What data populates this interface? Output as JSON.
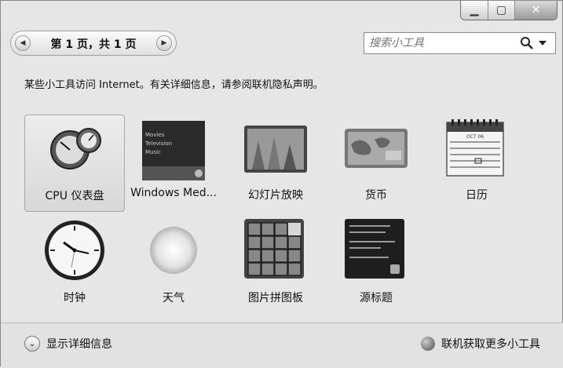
{
  "window": {
    "minimize_glyph": "▁",
    "maximize_glyph": "▢",
    "close_glyph": "✕"
  },
  "pager": {
    "text": "第 1 页，共 1 页",
    "prev_glyph": "◀",
    "next_glyph": "▶"
  },
  "search": {
    "placeholder": "搜索小工具",
    "icon": "search-icon",
    "dropdown_icon": "chevron-down-icon"
  },
  "notice": "某些小工具访问 Internet。有关详细信息，请参阅联机隐私声明。",
  "gadgets": [
    {
      "label": "CPU 仪表盘",
      "icon": "cpu-meter-icon",
      "selected": true
    },
    {
      "label": "Windows Med...",
      "icon": "windows-media-center-icon",
      "selected": false
    },
    {
      "label": "幻灯片放映",
      "icon": "slideshow-icon",
      "selected": false
    },
    {
      "label": "货币",
      "icon": "currency-icon",
      "selected": false
    },
    {
      "label": "日历",
      "icon": "calendar-icon",
      "selected": false
    },
    {
      "label": "时钟",
      "icon": "clock-icon",
      "selected": false
    },
    {
      "label": "天气",
      "icon": "weather-icon",
      "selected": false
    },
    {
      "label": "图片拼图板",
      "icon": "picture-puzzle-icon",
      "selected": false
    },
    {
      "label": "源标题",
      "icon": "feed-headlines-icon",
      "selected": false
    }
  ],
  "gadget_art_text": {
    "media_center": [
      "Movies",
      "Television",
      "Music"
    ],
    "calendar_month": "OCT 06"
  },
  "footer": {
    "details_label": "显示详细信息",
    "details_glyph": "⌄",
    "more_label": "联机获取更多小工具",
    "more_icon": "globe-icon"
  }
}
